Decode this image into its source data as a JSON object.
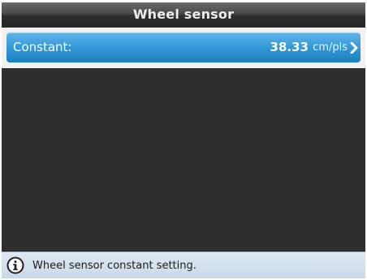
{
  "header": {
    "title": "Wheel sensor"
  },
  "list": {
    "items": [
      {
        "label": "Constant:",
        "value": "38.33",
        "unit": "cm/pls",
        "icon": "chevron-right-icon"
      }
    ]
  },
  "status": {
    "icon": "info-icon",
    "text": "Wheel sensor constant setting."
  },
  "colors": {
    "background": "#2f2e2c",
    "selected_item": "#3398d8",
    "status_bar": "#d4e1ee"
  }
}
